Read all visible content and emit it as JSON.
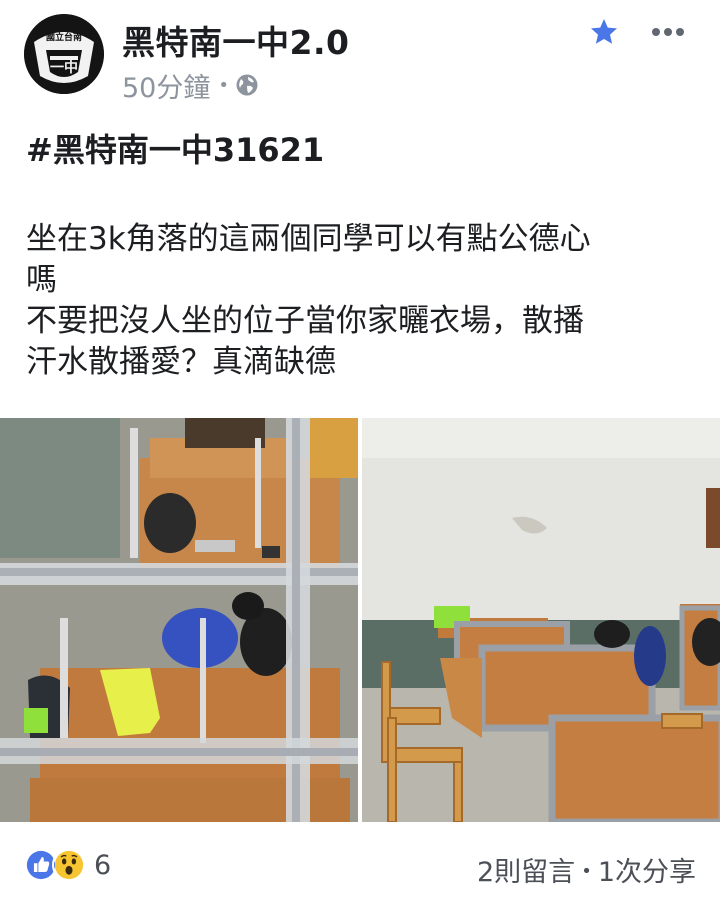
{
  "header": {
    "page_name": "黑特南一中2.0",
    "timestamp": "50分鐘",
    "separator": "•",
    "avatar_text_top": "國立台南",
    "avatar_text_main": "一中"
  },
  "post": {
    "hashtag": "#黑特南一中31621",
    "lines": [
      "坐在3k角落的這兩個同學可以有點公德心",
      "嗎",
      "不要把沒人坐的位子當你家曬衣場，散播",
      "汗水散播愛？真滴缺德"
    ]
  },
  "footer": {
    "reaction_count": "6",
    "comments": "2則留言",
    "separator": "•",
    "shares": "1次分享"
  },
  "icons": {
    "star": "star-icon",
    "more": "more-options-icon",
    "globe": "globe-icon",
    "like": "like-reaction-icon",
    "wow": "wow-reaction-icon"
  },
  "colors": {
    "accent_blue": "#4a76e8",
    "meta_gray": "#8d949e"
  }
}
